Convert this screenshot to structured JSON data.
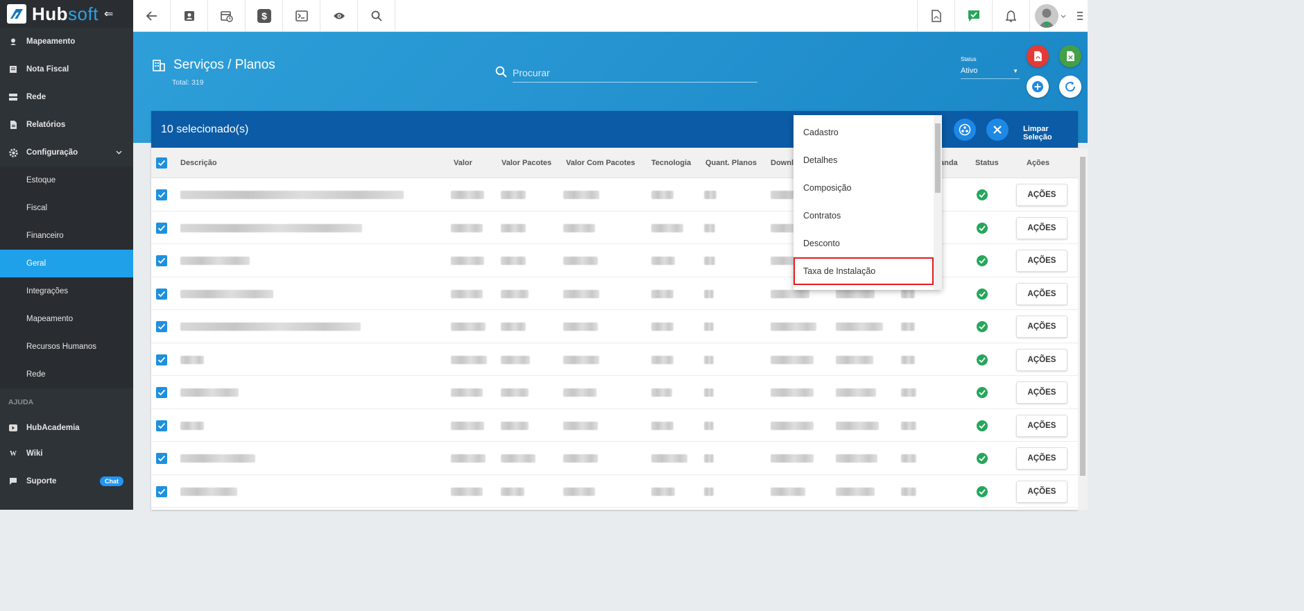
{
  "app": {
    "brand_primary": "Hub",
    "brand_secondary": "soft"
  },
  "sidebar": {
    "items": [
      {
        "label": "Mapeamento",
        "icon": "map-pin-icon"
      },
      {
        "label": "Nota Fiscal",
        "icon": "invoice-icon"
      },
      {
        "label": "Rede",
        "icon": "server-icon"
      },
      {
        "label": "Relatórios",
        "icon": "report-icon"
      },
      {
        "label": "Configuração",
        "icon": "gear-icon",
        "expanded": true
      }
    ],
    "sub_items": [
      "Estoque",
      "Fiscal",
      "Financeiro",
      "Geral",
      "Integrações",
      "Mapeamento",
      "Recursos Humanos",
      "Rede"
    ],
    "active_sub": "Geral",
    "help_section": "AJUDA",
    "help_items": [
      {
        "label": "HubAcademia",
        "icon": "youtube-icon"
      },
      {
        "label": "Wiki",
        "icon": "wiki-icon"
      },
      {
        "label": "Suporte",
        "icon": "chat-icon",
        "badge": "Chat"
      }
    ]
  },
  "header": {
    "title": "Serviços / Planos",
    "total": "Total: 319",
    "search_placeholder": "Procurar",
    "status_label": "Status",
    "status_value": "Ativo"
  },
  "selection": {
    "count_text": "10 selecionado(s)",
    "clear_label": "Limpar Seleção"
  },
  "table": {
    "columns": [
      "Descrição",
      "Valor",
      "Valor Pacotes",
      "Valor Com Pacotes",
      "Tecnologia",
      "Quant. Planos",
      "Downlo",
      "anda",
      "Status",
      "Ações"
    ],
    "action_label": "AÇÕES",
    "row_count": 10
  },
  "dropdown": {
    "items": [
      "Cadastro",
      "Detalhes",
      "Composição",
      "Contratos",
      "Desconto",
      "Taxa de Instalação"
    ],
    "highlighted": "Taxa de Instalação"
  },
  "colors": {
    "sidebar_bg": "#2e3338",
    "accent": "#1fa1ea",
    "selection_bar": "#0b5ba6",
    "status_ok": "#26a65b",
    "highlight": "#e41b1b"
  }
}
